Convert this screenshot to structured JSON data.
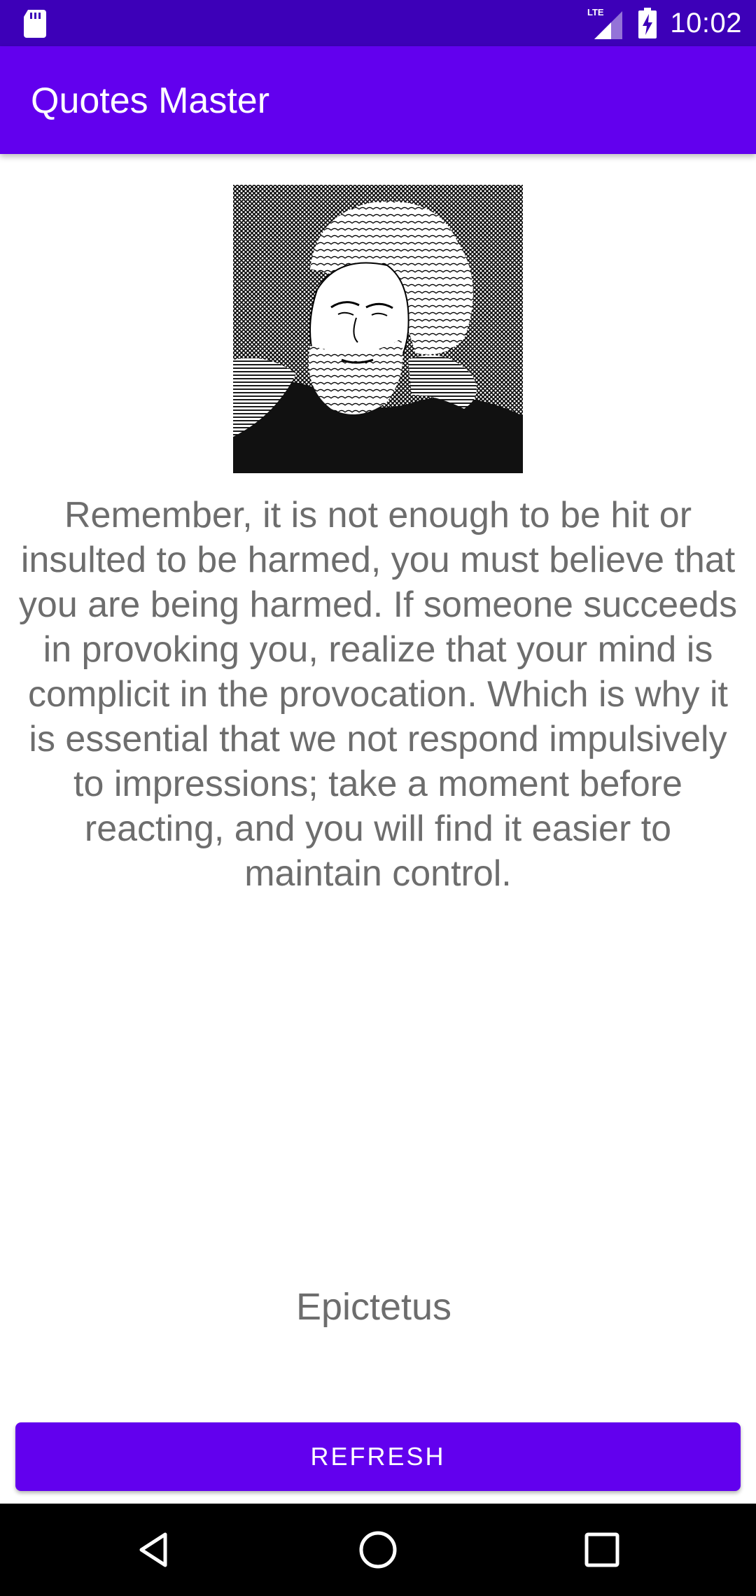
{
  "status_bar": {
    "time": "10:02",
    "network_label": "LTE",
    "icons": [
      "sd-card-icon",
      "signal-icon",
      "battery-charging-icon"
    ]
  },
  "app_bar": {
    "title": "Quotes Master"
  },
  "quote": {
    "text": "Remember, it is not enough to be hit or insulted to be harmed, you must believe that you are being harmed. If someone succeeds in provoking you, realize that your mind is complicit in the provocation. Which is why it is essential that we not respond impulsively to impressions; take a moment before reacting, and you will find it easier to maintain control.",
    "author": "Epictetus"
  },
  "actions": {
    "refresh_label": "REFRESH"
  },
  "nav_bar": {
    "icons": [
      "back-icon",
      "home-icon",
      "recents-icon"
    ]
  },
  "colors": {
    "status_bar": "#3d00b8",
    "primary": "#6200ee",
    "text": "#6d6d6d"
  }
}
